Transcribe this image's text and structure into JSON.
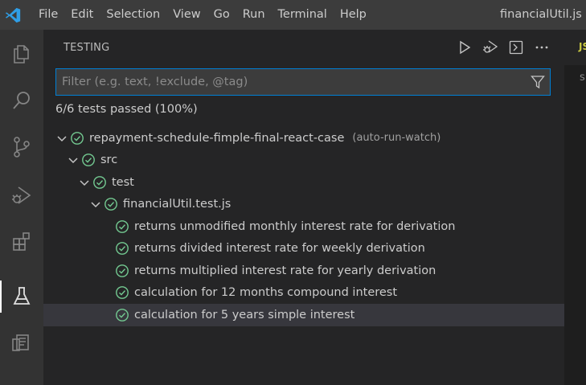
{
  "menu": {
    "items": [
      "File",
      "Edit",
      "Selection",
      "View",
      "Go",
      "Run",
      "Terminal",
      "Help"
    ]
  },
  "window": {
    "title": "financialUtil.js - r"
  },
  "activity_bar": {
    "icons": [
      "explorer-icon",
      "search-icon",
      "source-control-icon",
      "run-debug-icon",
      "extensions-icon",
      "testing-icon",
      "remote-explorer-icon"
    ],
    "active": "testing-icon"
  },
  "sidebar": {
    "title": "TESTING",
    "actions": [
      "run-all-tests-icon",
      "debug-all-tests-icon",
      "show-output-icon",
      "more-actions-icon"
    ],
    "filter": {
      "placeholder": "Filter (e.g. text, !exclude, @tag)",
      "value": ""
    },
    "summary": "6/6 tests passed (100%)",
    "tree": [
      {
        "label": "repayment-schedule-fimple-final-react-case",
        "description": "(auto-run-watch)",
        "depth": 0,
        "expandable": true,
        "status": "passed"
      },
      {
        "label": "src",
        "description": "",
        "depth": 1,
        "expandable": true,
        "status": "passed"
      },
      {
        "label": "test",
        "description": "",
        "depth": 2,
        "expandable": true,
        "status": "passed"
      },
      {
        "label": "financialUtil.test.js",
        "description": "",
        "depth": 3,
        "expandable": true,
        "status": "passed"
      },
      {
        "label": "returns unmodified monthly interest rate for derivation",
        "description": "",
        "depth": 4,
        "expandable": false,
        "status": "passed"
      },
      {
        "label": "returns divided interest rate for weekly derivation",
        "description": "",
        "depth": 4,
        "expandable": false,
        "status": "passed"
      },
      {
        "label": "returns multiplied interest rate for yearly derivation",
        "description": "",
        "depth": 4,
        "expandable": false,
        "status": "passed"
      },
      {
        "label": "calculation for 12 months compound interest",
        "description": "",
        "depth": 4,
        "expandable": false,
        "status": "passed"
      },
      {
        "label": "calculation for 5 years simple interest",
        "description": "",
        "depth": 4,
        "expandable": false,
        "status": "passed",
        "selected": true
      }
    ]
  },
  "editor": {
    "tab_prefix": "JS",
    "text": "s"
  },
  "colors": {
    "titlebar": "#3c3c3c",
    "activitybar": "#333333",
    "sidebar": "#252526",
    "accent": "#007fd4",
    "pass": "#73c991",
    "selection": "#37373d"
  }
}
